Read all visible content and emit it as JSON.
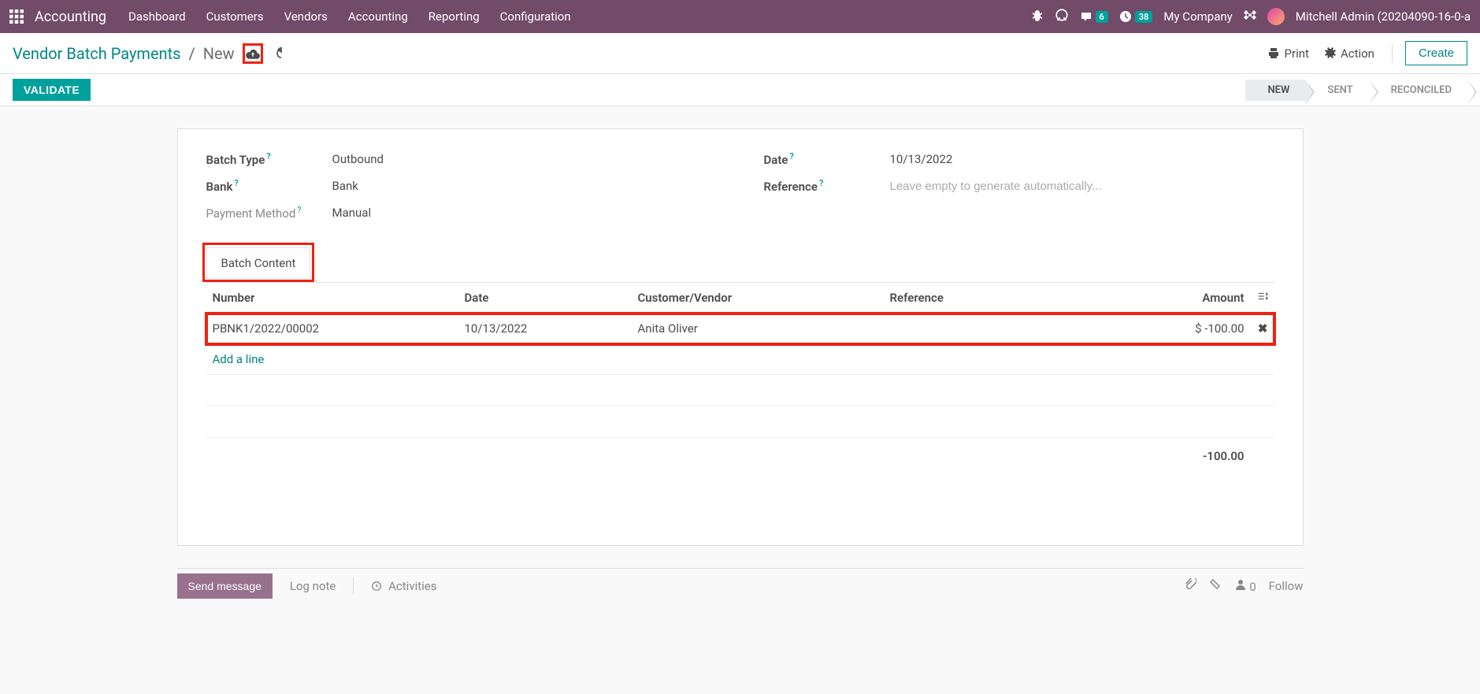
{
  "navbar": {
    "app_name": "Accounting",
    "menu": [
      "Dashboard",
      "Customers",
      "Vendors",
      "Accounting",
      "Reporting",
      "Configuration"
    ],
    "chat_badge": "6",
    "clock_badge": "38",
    "company": "My Company",
    "user": "Mitchell Admin (20204090-16-0-a"
  },
  "control": {
    "breadcrumb_root": "Vendor Batch Payments",
    "breadcrumb_last": "New",
    "print": "Print",
    "action": "Action",
    "create": "Create"
  },
  "status": {
    "validate": "VALIDATE",
    "steps": [
      "NEW",
      "SENT",
      "RECONCILED"
    ]
  },
  "form": {
    "batch_type_label": "Batch Type",
    "batch_type_value": "Outbound",
    "bank_label": "Bank",
    "bank_value": "Bank",
    "pm_label": "Payment Method",
    "pm_value": "Manual",
    "date_label": "Date",
    "date_value": "10/13/2022",
    "ref_label": "Reference",
    "ref_placeholder": "Leave empty to generate automatically..."
  },
  "tabs": {
    "batch_content": "Batch Content"
  },
  "table": {
    "headers": {
      "number": "Number",
      "date": "Date",
      "cv": "Customer/Vendor",
      "ref": "Reference",
      "amount": "Amount"
    },
    "rows": [
      {
        "number": "PBNK1/2022/00002",
        "date": "10/13/2022",
        "cv": "Anita Oliver",
        "ref": "",
        "amount": "$ -100.00"
      }
    ],
    "add_line": "Add a line",
    "total": "-100.00"
  },
  "chatter": {
    "send": "Send message",
    "log": "Log note",
    "activities": "Activities",
    "follow": "Follow",
    "followers": "0"
  }
}
